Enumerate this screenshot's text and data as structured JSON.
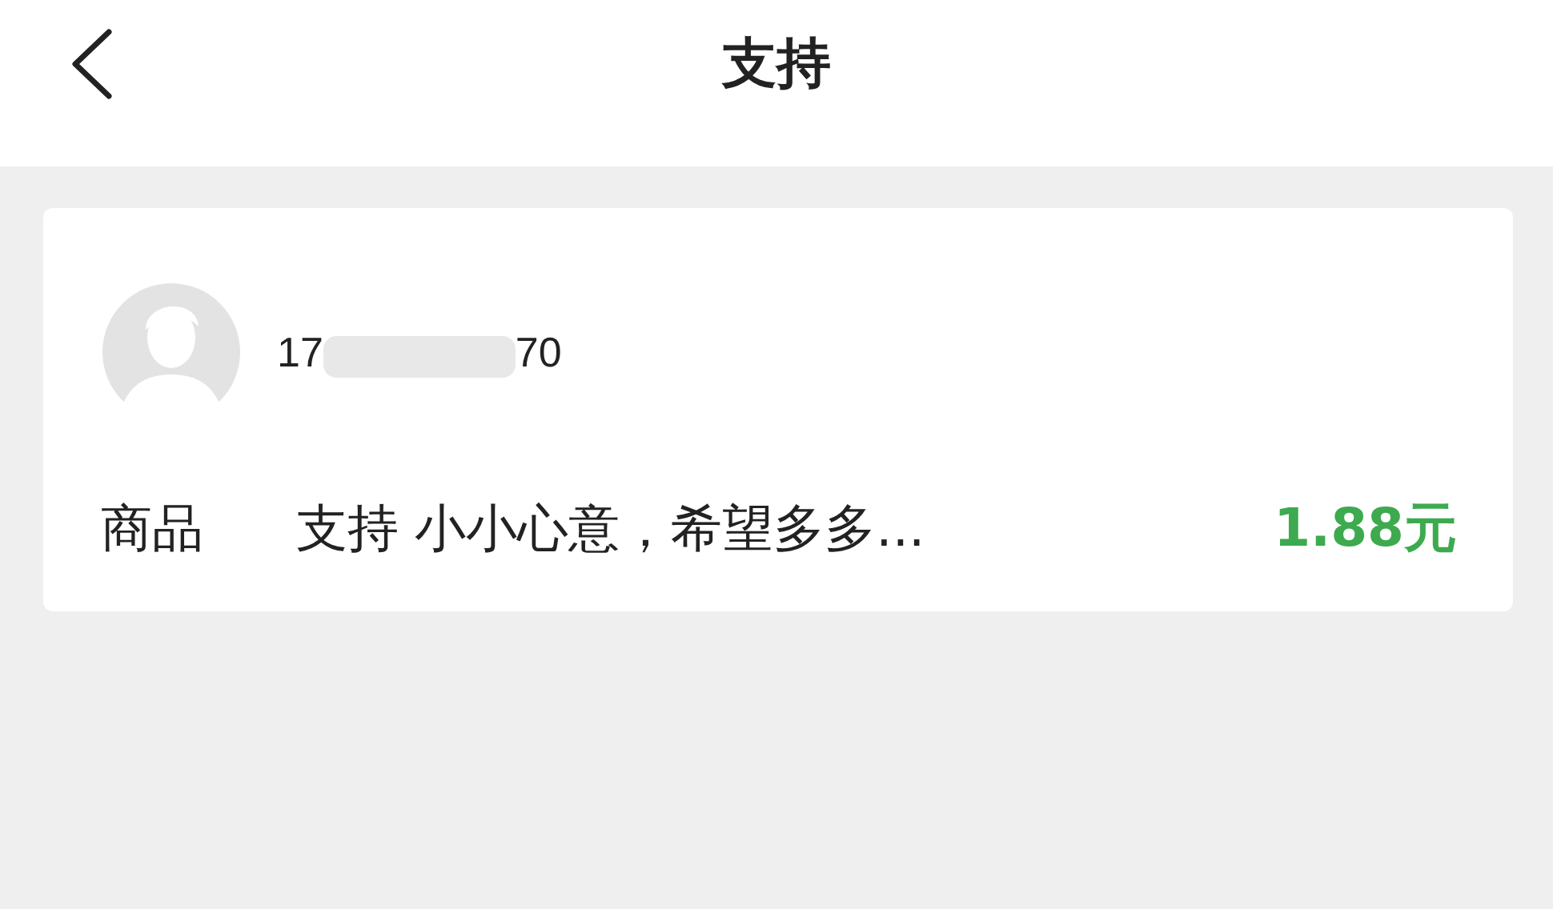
{
  "header": {
    "title": "支持"
  },
  "record": {
    "user": {
      "phone_start": "17",
      "phone_end": "70"
    },
    "label": "商品",
    "description": "支持 小小心意，希望多多...",
    "amount": "1.88元"
  }
}
